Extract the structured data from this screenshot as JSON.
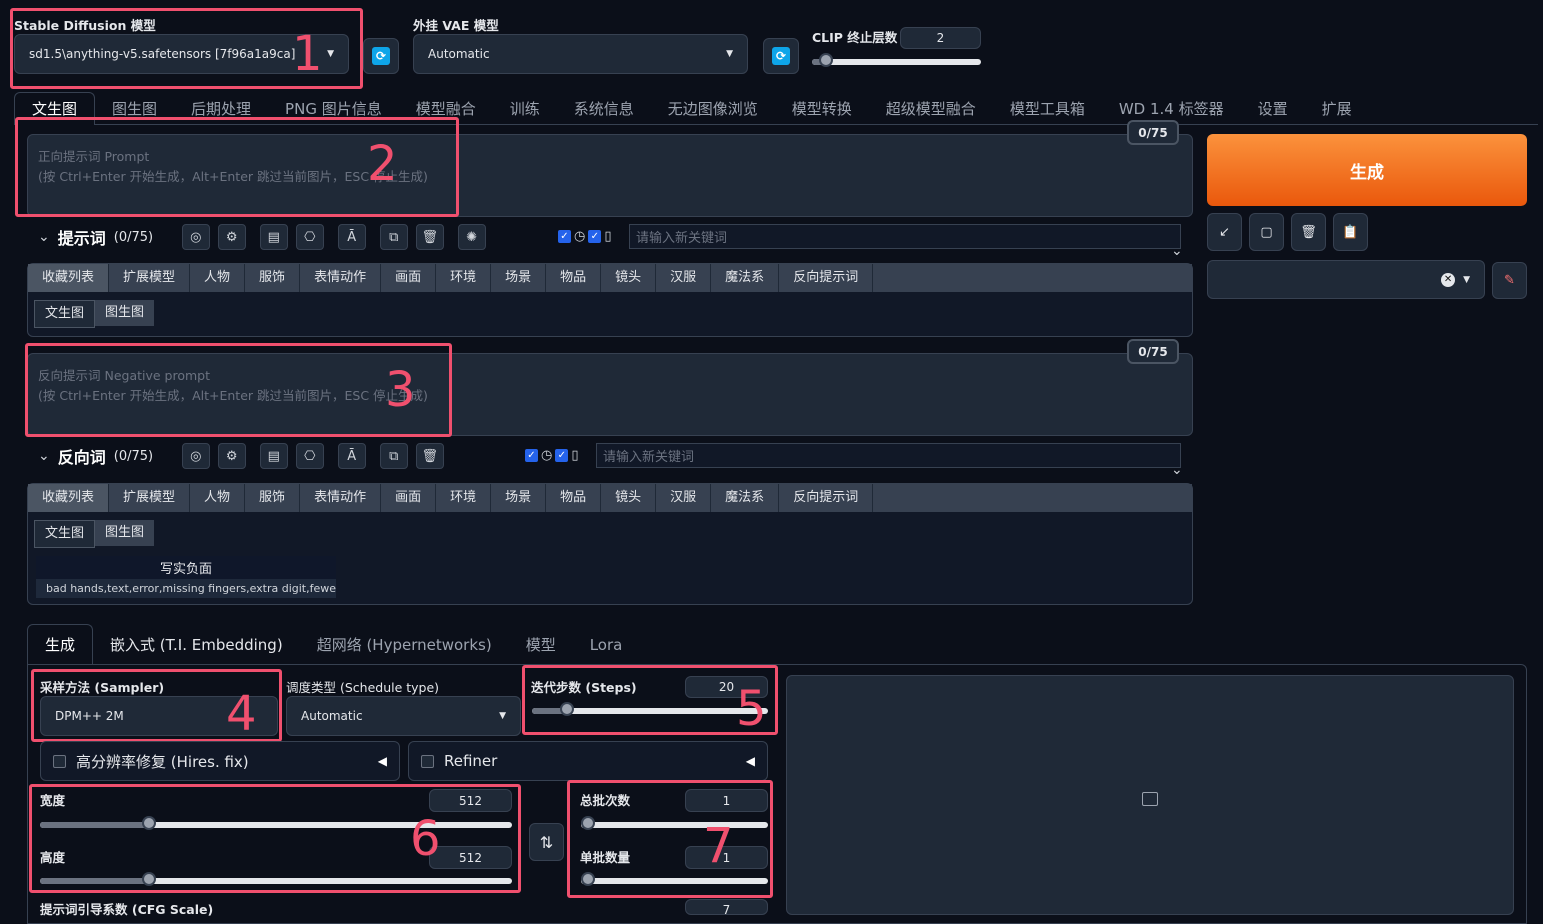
{
  "top": {
    "sd_model_label": "Stable Diffusion 模型",
    "sd_model_value": "sd1.5\\anything-v5.safetensors [7f96a1a9ca]",
    "vae_label": "外挂 VAE 模型",
    "vae_value": "Automatic",
    "clip_label": "CLIP 终止层数",
    "clip_value": "2",
    "clip_fraction": 0.08
  },
  "main_tabs": [
    "文生图",
    "图生图",
    "后期处理",
    "PNG 图片信息",
    "模型融合",
    "训练",
    "系统信息",
    "无边图像浏览",
    "模型转换",
    "超级模型融合",
    "模型工具箱",
    "WD 1.4 标签器",
    "设置",
    "扩展"
  ],
  "prompt": {
    "placeholder_line1": "正向提示词 Prompt",
    "placeholder_line2": "(按 Ctrl+Enter 开始生成，Alt+Enter 跳过当前图片，ESC 停止生成)",
    "counter": "0/75",
    "toolbar_title": "提示词",
    "toolbar_count": "(0/75)",
    "keyword_placeholder": "请输入新关键词"
  },
  "negative": {
    "placeholder_line1": "反向提示词 Negative prompt",
    "placeholder_line2": "(按 Ctrl+Enter 开始生成，Alt+Enter 跳过当前图片，ESC 停止生成)",
    "counter": "0/75",
    "toolbar_title": "反向词",
    "toolbar_count": "(0/75)",
    "keyword_placeholder": "请输入新关键词",
    "preset_title": "写实负面",
    "preset_text": "bad hands,text,error,missing fingers,extra digit,fewer ..."
  },
  "categories": [
    "收藏列表",
    "扩展模型",
    "人物",
    "服饰",
    "表情动作",
    "画面",
    "环境",
    "场景",
    "物品",
    "镜头",
    "汉服",
    "魔法系",
    "反向提示词"
  ],
  "subtabs": [
    "文生图",
    "图生图"
  ],
  "generate": {
    "label": "生成"
  },
  "gen_tabs": [
    "生成",
    "嵌入式 (T.I. Embedding)",
    "超网络 (Hypernetworks)",
    "模型",
    "Lora"
  ],
  "sampler": {
    "label": "采样方法 (Sampler)",
    "value": "DPM++ 2M"
  },
  "schedule": {
    "label": "调度类型 (Schedule type)",
    "value": "Automatic"
  },
  "steps": {
    "label": "迭代步数 (Steps)",
    "value": "20",
    "fraction": 0.15
  },
  "hires": {
    "label": "高分辨率修复 (Hires. fix)"
  },
  "refiner": {
    "label": "Refiner"
  },
  "width": {
    "label": "宽度",
    "value": "512",
    "fraction": 0.23
  },
  "height": {
    "label": "高度",
    "value": "512",
    "fraction": 0.23
  },
  "batch_count": {
    "label": "总批次数",
    "value": "1",
    "fraction": 0.0
  },
  "batch_size": {
    "label": "单批数量",
    "value": "1",
    "fraction": 0.0
  },
  "cfg": {
    "label": "提示词引导系数 (CFG Scale)",
    "value": "7"
  },
  "annotations": [
    "1",
    "2",
    "3",
    "4",
    "5",
    "6",
    "7"
  ],
  "colors": {
    "accent": "#f97316",
    "highlight": "#f0506e",
    "refresh": "#0ea5e9"
  }
}
